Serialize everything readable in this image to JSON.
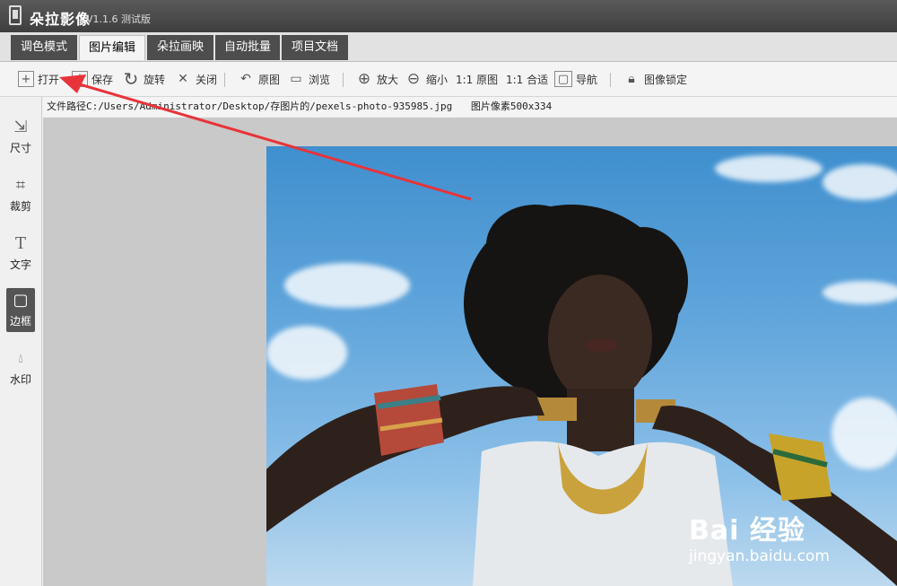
{
  "window": {
    "title": "朵拉影像",
    "version": "V1.1.6 测试版"
  },
  "tabs": [
    {
      "label": "调色模式"
    },
    {
      "label": "图片编辑"
    },
    {
      "label": "朵拉画映"
    },
    {
      "label": "自动批量"
    },
    {
      "label": "项目文档"
    }
  ],
  "toolbar": {
    "open": "打开",
    "save": "保存",
    "rotate": "旋转",
    "close": "关闭",
    "original": "原图",
    "browse": "浏览",
    "zoom_in": "放大",
    "zoom_out": "缩小",
    "actual": "1:1 原图",
    "fit": "1:1 合适",
    "navigate": "导航",
    "lock": "图像锁定"
  },
  "pathbar": {
    "file_path": "文件路径C:/Users/Administrator/Desktop/存图片的/pexels-photo-935985.jpg",
    "pixels": "图片像素500x334"
  },
  "sidebar": {
    "items": [
      {
        "label": "尺寸",
        "icon": "resize-icon"
      },
      {
        "label": "裁剪",
        "icon": "crop-icon"
      },
      {
        "label": "文字",
        "icon": "text-icon"
      },
      {
        "label": "边框",
        "icon": "border-icon"
      },
      {
        "label": "水印",
        "icon": "watermark-icon"
      }
    ]
  },
  "watermark": {
    "brand": "Bai 经验",
    "url": "jingyan.baidu.com"
  },
  "colors": {
    "annotation_arrow": "#e8333a",
    "tab_dark": "#4d4d4d"
  }
}
